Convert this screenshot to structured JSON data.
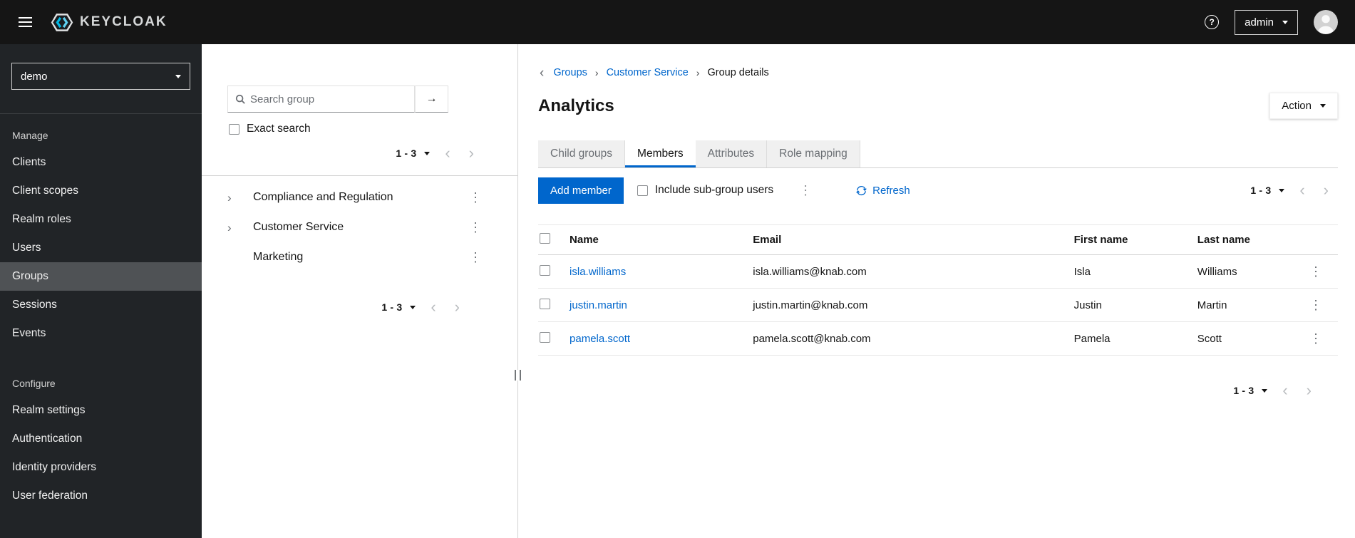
{
  "masthead": {
    "brand": "KEYCLOAK",
    "user": "admin"
  },
  "sidebar": {
    "realm": "demo",
    "sections": [
      {
        "label": "Manage",
        "items": [
          "Clients",
          "Client scopes",
          "Realm roles",
          "Users",
          "Groups",
          "Sessions",
          "Events"
        ]
      },
      {
        "label": "Configure",
        "items": [
          "Realm settings",
          "Authentication",
          "Identity providers",
          "User federation"
        ]
      }
    ],
    "active_item": "Groups"
  },
  "tree": {
    "search_placeholder": "Search group",
    "exact_search_label": "Exact search",
    "pagination_top": "1 - 3",
    "pagination_bottom": "1 - 3",
    "groups": [
      {
        "label": "Compliance and Regulation",
        "expandable": true
      },
      {
        "label": "Customer Service",
        "expandable": true
      },
      {
        "label": "Marketing",
        "expandable": false
      }
    ]
  },
  "main": {
    "breadcrumb": {
      "items": [
        "Groups",
        "Customer Service",
        "Group details"
      ]
    },
    "title": "Analytics",
    "action_label": "Action",
    "tabs": [
      "Child groups",
      "Members",
      "Attributes",
      "Role mapping"
    ],
    "active_tab": "Members",
    "toolbar": {
      "add_member_label": "Add member",
      "include_subgroups_label": "Include sub-group users",
      "refresh_label": "Refresh",
      "pagination": "1 - 3"
    },
    "table": {
      "headers": [
        "Name",
        "Email",
        "First name",
        "Last name"
      ],
      "rows": [
        {
          "name": "isla.williams",
          "email": "isla.williams@knab.com",
          "first_name": "Isla",
          "last_name": "Williams"
        },
        {
          "name": "justin.martin",
          "email": "justin.martin@knab.com",
          "first_name": "Justin",
          "last_name": "Martin"
        },
        {
          "name": "pamela.scott",
          "email": "pamela.scott@knab.com",
          "first_name": "Pamela",
          "last_name": "Scott"
        }
      ]
    },
    "pagination_bottom": "1 - 3"
  },
  "icons": {
    "kebab": "⋮",
    "chevron_right": "›",
    "chevron_left": "‹",
    "arrow_right": "→",
    "back": "‹",
    "breadcrumb_separator": "›",
    "question": "?"
  },
  "colors": {
    "accent_blue": "#0066cc",
    "masthead_bg": "#151515",
    "sidebar_bg": "#212427",
    "active_nav_bg": "#4f5255",
    "link_blue": "#0066cc"
  }
}
